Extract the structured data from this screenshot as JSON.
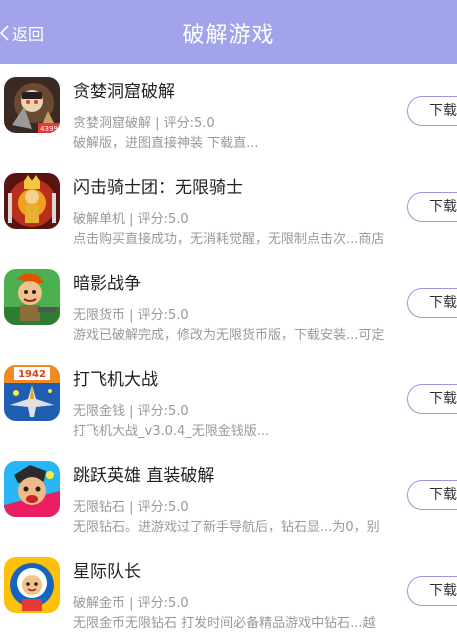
{
  "header": {
    "back_label": "返回",
    "title": "破解游戏",
    "bg_color": "#a3a3ec"
  },
  "games": [
    {
      "name": "贪婪洞窟破解",
      "meta": "贪婪洞窟破解 | 评分:5.0",
      "desc": "破解版，进图直接神装 下载直...",
      "download_label": "下载",
      "icon_label": "4399"
    },
    {
      "name": "闪击骑士团：无限骑士",
      "meta": "破解单机 | 评分:5.0",
      "desc": "点击购买直接成功，无消耗觉醒，无限制点击次...商店",
      "download_label": "下载"
    },
    {
      "name": "暗影战争",
      "meta": "无限货币 | 评分:5.0",
      "desc": "游戏已破解完成，修改为无限货币版，下载安装...可定",
      "download_label": "下载"
    },
    {
      "name": "打飞机大战",
      "meta": "无限金钱 | 评分:5.0",
      "desc": "打飞机大战_v3.0.4_无限金钱版...",
      "download_label": "下载",
      "icon_label": "1942"
    },
    {
      "name": "跳跃英雄 直装破解",
      "meta": "无限钻石 | 评分:5.0",
      "desc": "无限钻石。进游戏过了新手导航后，钻石显...为0，别",
      "download_label": "下载"
    },
    {
      "name": "星际队长",
      "meta": "破解金币 | 评分:5.0",
      "desc": "无限金币无限钻石 打发时间必备精品游戏中钻石...越",
      "download_label": "下载"
    }
  ]
}
